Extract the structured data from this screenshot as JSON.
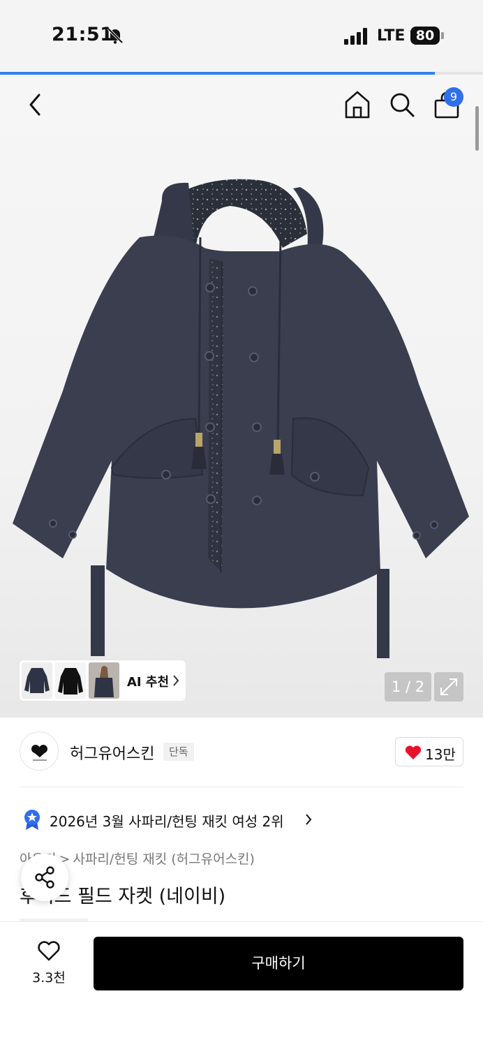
{
  "status_bar": {
    "time": "21:51",
    "network": "LTE",
    "battery": "80",
    "bell_icon": "bell-slash-icon"
  },
  "page_progress": {
    "percent": 90
  },
  "nav": {
    "back_icon": "chevron-left-icon",
    "home_icon": "home-icon",
    "search_icon": "search-icon",
    "cart_icon": "shopping-bag-icon",
    "cart_count": "9"
  },
  "gallery": {
    "ai_label": "AI 추천",
    "counter": "1 / 2",
    "thumbnails": [
      "navy-jacket-thumb",
      "black-jacket-thumb",
      "model-thumb"
    ]
  },
  "brand": {
    "name": "허그유어스킨",
    "tag": "단독",
    "likes": "13만"
  },
  "ranking": {
    "text": "2026년 3월 사파리/헌팅 재킷 여성 2위"
  },
  "breadcrumb": {
    "category": "아우터",
    "sep": ">",
    "subcategory": "사파리/헌팅 재킷 (허그유어스킨)"
  },
  "product": {
    "title": "후디드 필드 자켓 (네이비)"
  },
  "bottom": {
    "wish_count": "3.3천",
    "buy_label": "구매하기"
  },
  "colors": {
    "accent": "#2f80ed",
    "heart": "#e8132b",
    "jacket_navy": "#3a3e4f"
  }
}
